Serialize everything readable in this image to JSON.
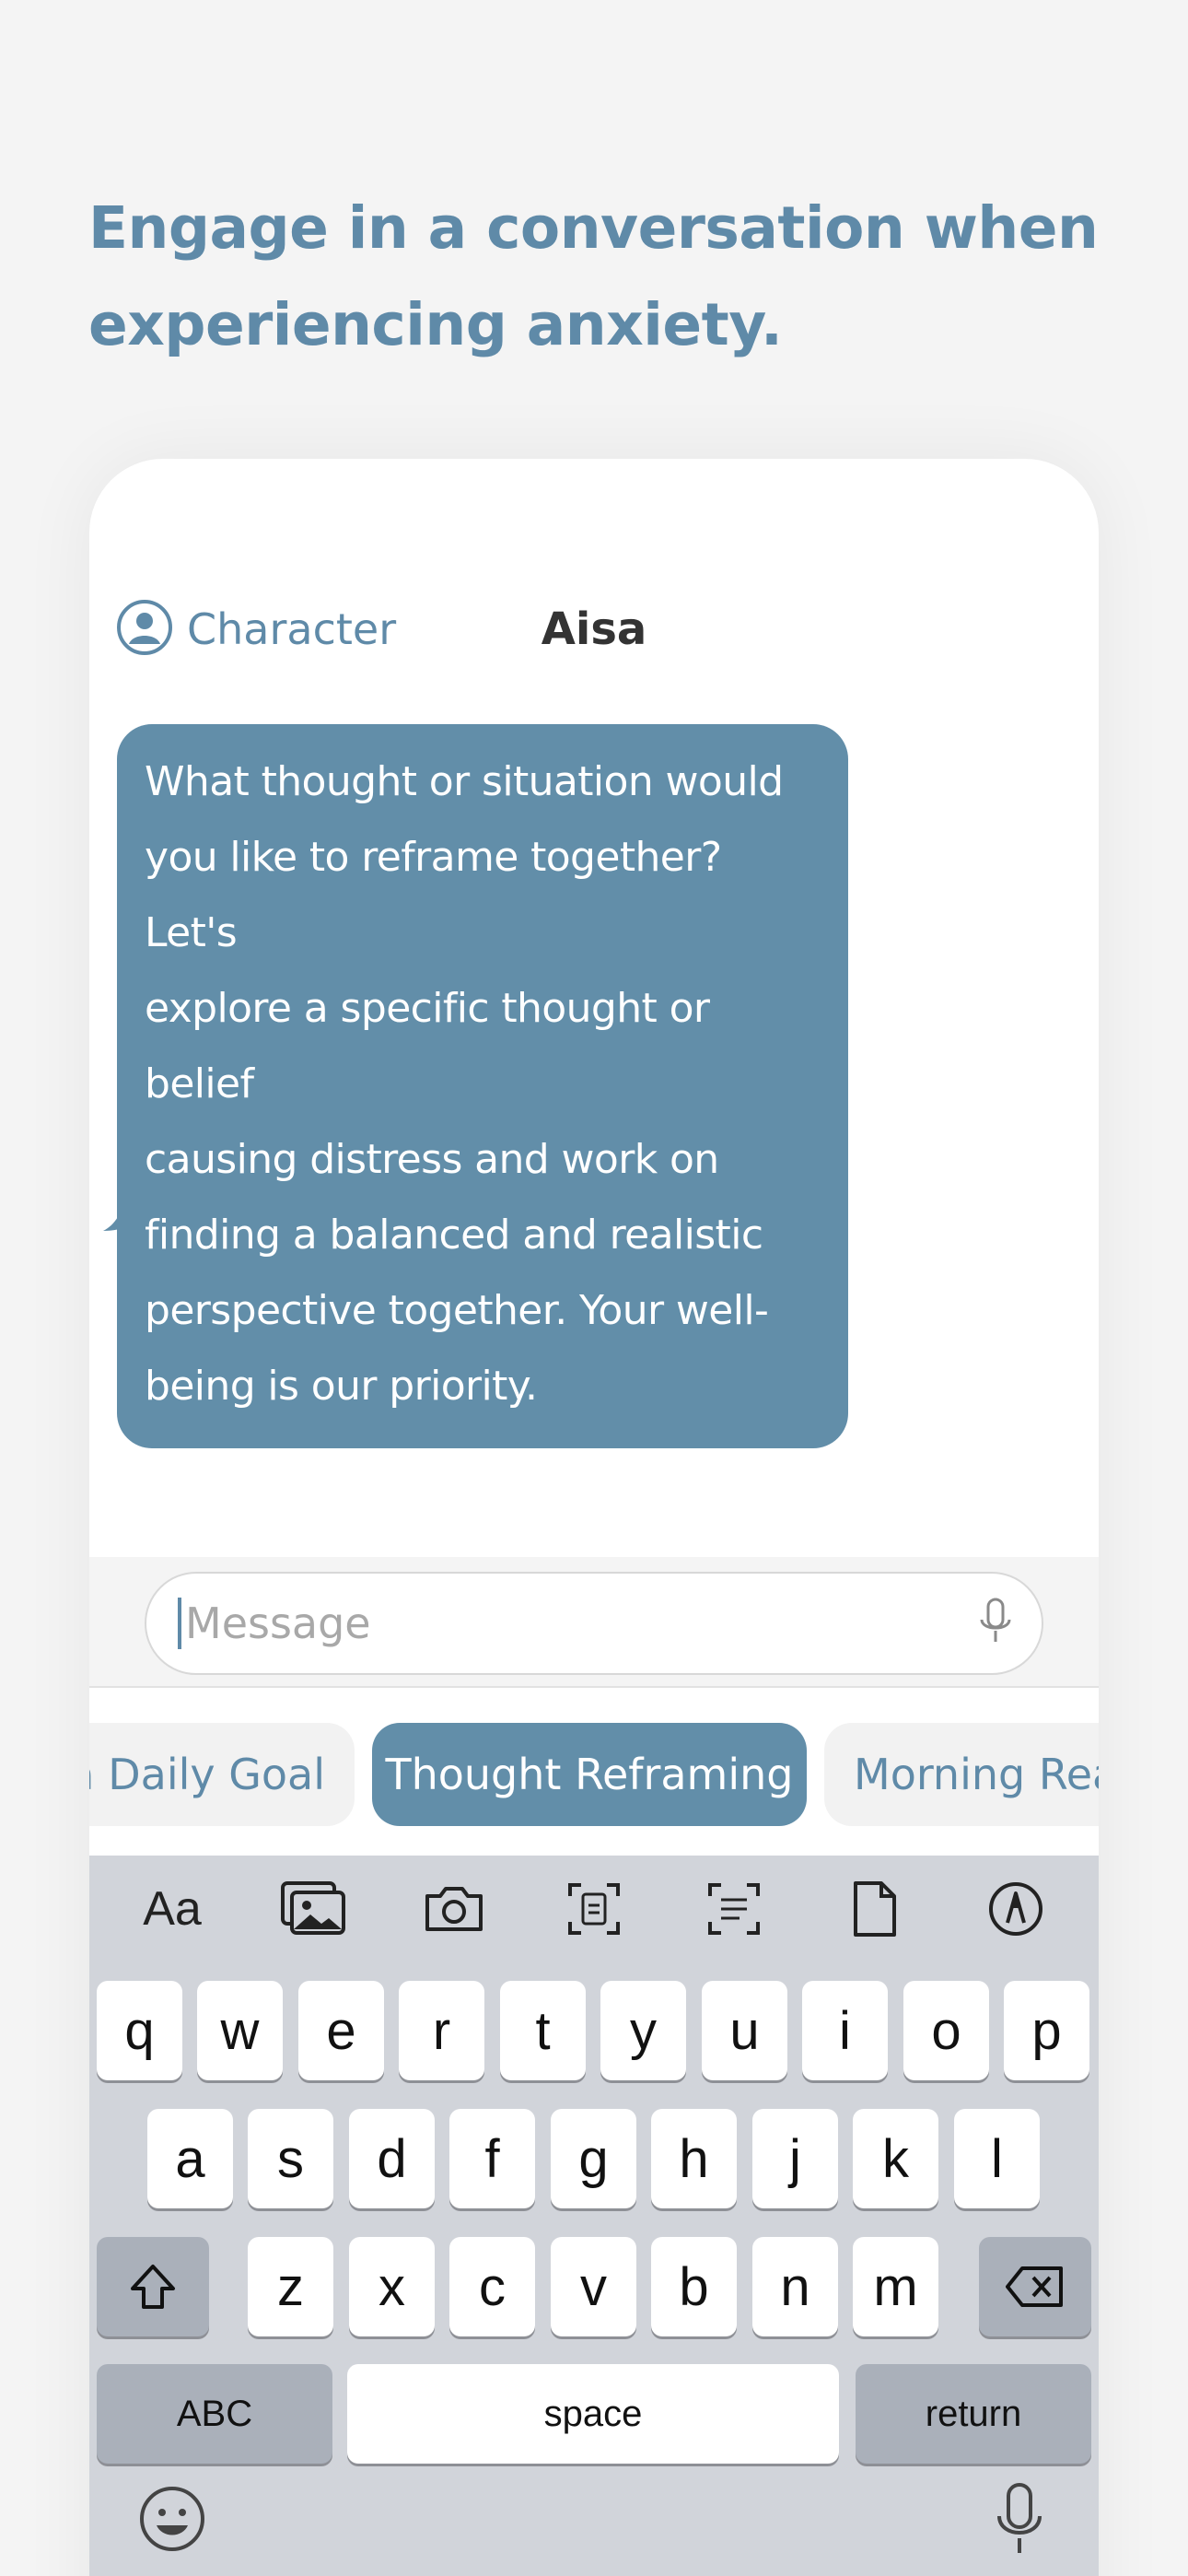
{
  "headline": "Engage in a conversation when experiencing anxiety.",
  "header": {
    "character_label": "Character",
    "title": "Aisa"
  },
  "message": {
    "text": "What thought or situation would you like to reframe together? Let's explore a specific thought or belief causing distress and work on finding a balanced and realistic perspective together. Your well-being is our priority.",
    "lines": [
      "What thought or situation would",
      "you like to reframe together? Let's",
      "explore a specific thought or belief",
      "causing distress and work on",
      "finding a balanced and realistic",
      "perspective together. Your well-",
      "being is our priority."
    ]
  },
  "composer": {
    "placeholder": "Message"
  },
  "chips": [
    "a Daily Goal",
    "Thought Reframing",
    "Morning Rea"
  ],
  "keyboard": {
    "toolbar": [
      "Aa",
      "photo-library-icon",
      "camera-icon",
      "scan-document-icon",
      "scan-text-icon",
      "document-icon",
      "markup-icon"
    ],
    "row1": [
      "q",
      "w",
      "e",
      "r",
      "t",
      "y",
      "u",
      "i",
      "o",
      "p"
    ],
    "row2": [
      "a",
      "s",
      "d",
      "f",
      "g",
      "h",
      "j",
      "k",
      "l"
    ],
    "row3": [
      "z",
      "x",
      "c",
      "v",
      "b",
      "n",
      "m"
    ],
    "abc": "ABC",
    "space": "space",
    "return": "return"
  },
  "colors": {
    "accent": "#5f8aa8",
    "bubble": "#628ea9",
    "background": "#f4f4f4",
    "keyboard": "#d1d4da"
  }
}
